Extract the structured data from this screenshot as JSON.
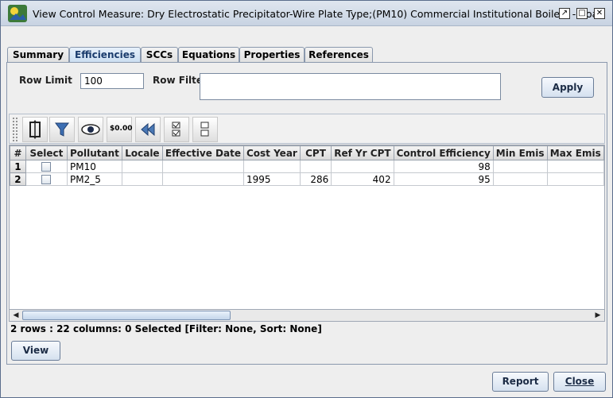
{
  "window": {
    "title": "View Control Measure: Dry Electrostatic Precipitator-Wire Plate Type;(PM10) Commercial Institutional Boilers - Coal"
  },
  "tabs": [
    {
      "label": "Summary",
      "active": false
    },
    {
      "label": "Efficiencies",
      "active": true
    },
    {
      "label": "SCCs",
      "active": false
    },
    {
      "label": "Equations",
      "active": false
    },
    {
      "label": "Properties",
      "active": false
    },
    {
      "label": "References",
      "active": false
    }
  ],
  "filter": {
    "row_limit_label": "Row Limit",
    "row_limit_value": "100",
    "row_filter_label": "Row Filter",
    "row_filter_value": "",
    "apply_label": "Apply"
  },
  "toolbar": {
    "icons": [
      "column-resize-icon",
      "filter-icon",
      "view-eye-icon",
      "format-dollar-icon",
      "reset-rewind-icon",
      "select-all-icon",
      "clear-selection-icon"
    ],
    "dollar_text": "$0.00"
  },
  "table": {
    "columns": [
      "#",
      "Select",
      "Pollutant",
      "Locale",
      "Effective Date",
      "Cost Year",
      "CPT",
      "Ref Yr CPT",
      "Control Efficiency",
      "Min Emis",
      "Max Emis"
    ],
    "rows": [
      {
        "num": "1",
        "pollutant": "PM10",
        "locale": "",
        "effective_date": "",
        "cost_year": "",
        "cpt": "",
        "ref_yr_cpt": "",
        "control_efficiency": "98",
        "min_emis": "",
        "max_emis": ""
      },
      {
        "num": "2",
        "pollutant": "PM2_5",
        "locale": "",
        "effective_date": "",
        "cost_year": "1995",
        "cpt": "286",
        "ref_yr_cpt": "402",
        "control_efficiency": "95",
        "min_emis": "",
        "max_emis": ""
      }
    ]
  },
  "status_text": "2 rows : 22 columns: 0 Selected [Filter: None, Sort: None]",
  "buttons": {
    "view": "View",
    "report": "Report",
    "close": "Close"
  }
}
